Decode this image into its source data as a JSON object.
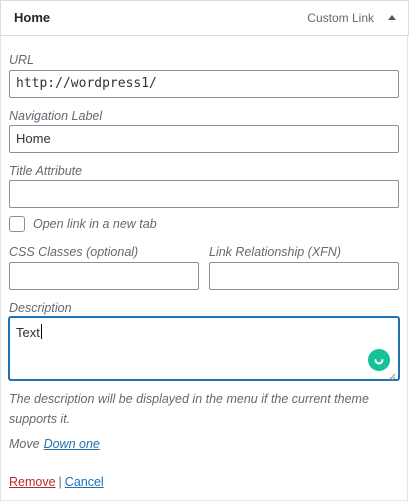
{
  "header": {
    "title": "Home",
    "type_label": "Custom Link"
  },
  "fields": {
    "url": {
      "label": "URL",
      "value": "http://wordpress1/"
    },
    "navigation_label": {
      "label": "Navigation Label",
      "value": "Home"
    },
    "title_attribute": {
      "label": "Title Attribute",
      "value": ""
    },
    "open_new_tab": {
      "label": "Open link in a new tab",
      "checked": false
    },
    "css_classes": {
      "label": "CSS Classes (optional)",
      "value": ""
    },
    "link_relationship": {
      "label": "Link Relationship (XFN)",
      "value": ""
    },
    "description": {
      "label": "Description",
      "value": "Text",
      "help": "The description will be displayed in the menu if the current theme supports it."
    }
  },
  "move": {
    "label": "Move",
    "down_one": "Down one"
  },
  "actions": {
    "remove": "Remove",
    "separator": "|",
    "cancel": "Cancel"
  },
  "colors": {
    "accent": "#2271b1",
    "danger": "#b32d2e",
    "grammarly": "#15c39a"
  }
}
